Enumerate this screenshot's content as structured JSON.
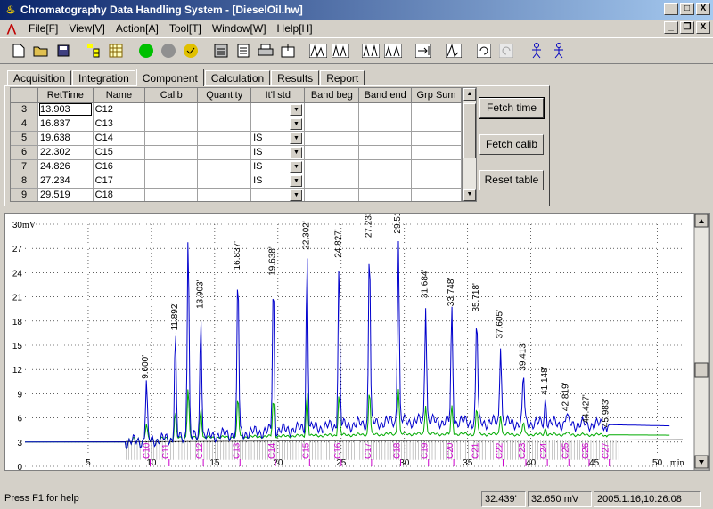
{
  "window": {
    "title": "Chromatography Data Handling System - [DieselOil.hw]",
    "min": "_",
    "max": "□",
    "close": "X",
    "restore": "❐"
  },
  "menu": [
    "File[F]",
    "View[V]",
    "Action[A]",
    "Tool[T]",
    "Window[W]",
    "Help[H]"
  ],
  "tabs": [
    "Acquisition",
    "Integration",
    "Component",
    "Calculation",
    "Results",
    "Report"
  ],
  "table": {
    "headers": [
      "",
      "RetTime",
      "Name",
      "Calib",
      "Quantity",
      "It'l std",
      "Band beg",
      "Band end",
      "Grp Sum"
    ],
    "rows": [
      {
        "n": "3",
        "ret": "13.903",
        "name": "C12",
        "std": ""
      },
      {
        "n": "4",
        "ret": "16.837",
        "name": "C13",
        "std": ""
      },
      {
        "n": "5",
        "ret": "19.638",
        "name": "C14",
        "std": "IS"
      },
      {
        "n": "6",
        "ret": "22.302",
        "name": "C15",
        "std": "IS"
      },
      {
        "n": "7",
        "ret": "24.826",
        "name": "C16",
        "std": "IS"
      },
      {
        "n": "8",
        "ret": "27.234",
        "name": "C17",
        "std": "IS"
      },
      {
        "n": "9",
        "ret": "29.519",
        "name": "C18",
        "std": ""
      }
    ]
  },
  "buttons": {
    "fetch_time": "Fetch time",
    "fetch_calib": "Fetch calib",
    "reset": "Reset table"
  },
  "chart_data": {
    "type": "line",
    "ylabel": "mV",
    "xlabel": "min",
    "ylim": [
      0,
      30
    ],
    "xlim": [
      0,
      52
    ],
    "yticks": [
      "0",
      "3",
      "6",
      "9",
      "12",
      "15",
      "18",
      "21",
      "24",
      "27",
      "30"
    ],
    "xticks": [
      "5",
      "10",
      "15",
      "20",
      "25",
      "30",
      "35",
      "40",
      "45",
      "50"
    ],
    "peaks": [
      {
        "x": 9.6,
        "y": 10.5,
        "label": "9.600'"
      },
      {
        "x": 11.892,
        "y": 16.5,
        "label": "11.892'"
      },
      {
        "x": 12.9,
        "y": 29.5,
        "label": ""
      },
      {
        "x": 13.903,
        "y": 19.2,
        "label": "13.903'"
      },
      {
        "x": 16.837,
        "y": 24.0,
        "label": "16.837'"
      },
      {
        "x": 19.638,
        "y": 23.3,
        "label": "19.638'"
      },
      {
        "x": 22.302,
        "y": 26.5,
        "label": "22.302'"
      },
      {
        "x": 24.826,
        "y": 25.5,
        "label": "24.827'"
      },
      {
        "x": 27.234,
        "y": 28.0,
        "label": "27.233'"
      },
      {
        "x": 29.519,
        "y": 28.5,
        "label": "29.517'"
      },
      {
        "x": 31.684,
        "y": 20.5,
        "label": "31.684'"
      },
      {
        "x": 33.748,
        "y": 19.5,
        "label": "33.748'"
      },
      {
        "x": 35.718,
        "y": 18.8,
        "label": "35.718'"
      },
      {
        "x": 37.605,
        "y": 15.5,
        "label": "37.605'"
      },
      {
        "x": 39.413,
        "y": 11.5,
        "label": "39.413'"
      },
      {
        "x": 41.148,
        "y": 8.5,
        "label": "41.148'"
      },
      {
        "x": 42.819,
        "y": 6.5,
        "label": "42.819'"
      },
      {
        "x": 44.427,
        "y": 5.0,
        "label": "44.427'"
      },
      {
        "x": 45.983,
        "y": 4.5,
        "label": "45.983'"
      }
    ],
    "components": [
      {
        "x": 9.9,
        "label": "C10"
      },
      {
        "x": 11.4,
        "label": "C11"
      },
      {
        "x": 14.1,
        "label": "C12"
      },
      {
        "x": 17.0,
        "label": "C13"
      },
      {
        "x": 19.8,
        "label": "C14"
      },
      {
        "x": 22.5,
        "label": "C15"
      },
      {
        "x": 25.0,
        "label": "C16"
      },
      {
        "x": 27.4,
        "label": "C17"
      },
      {
        "x": 29.7,
        "label": "C18"
      },
      {
        "x": 31.9,
        "label": "C19"
      },
      {
        "x": 33.9,
        "label": "C20"
      },
      {
        "x": 35.9,
        "label": "C21"
      },
      {
        "x": 37.8,
        "label": "C22"
      },
      {
        "x": 39.6,
        "label": "C23"
      },
      {
        "x": 41.3,
        "label": "C24"
      },
      {
        "x": 43.0,
        "label": "C25"
      },
      {
        "x": 44.6,
        "label": "C26"
      },
      {
        "x": 46.2,
        "label": "C27"
      }
    ],
    "colors": {
      "signal": "#0000cc",
      "baseline": "#00aa00",
      "marker": "#cc00cc"
    }
  },
  "status": {
    "help": "Press F1 for help",
    "time": "32.439'",
    "mv": "32.650 mV",
    "date": "2005.1.16,10:26:08"
  }
}
